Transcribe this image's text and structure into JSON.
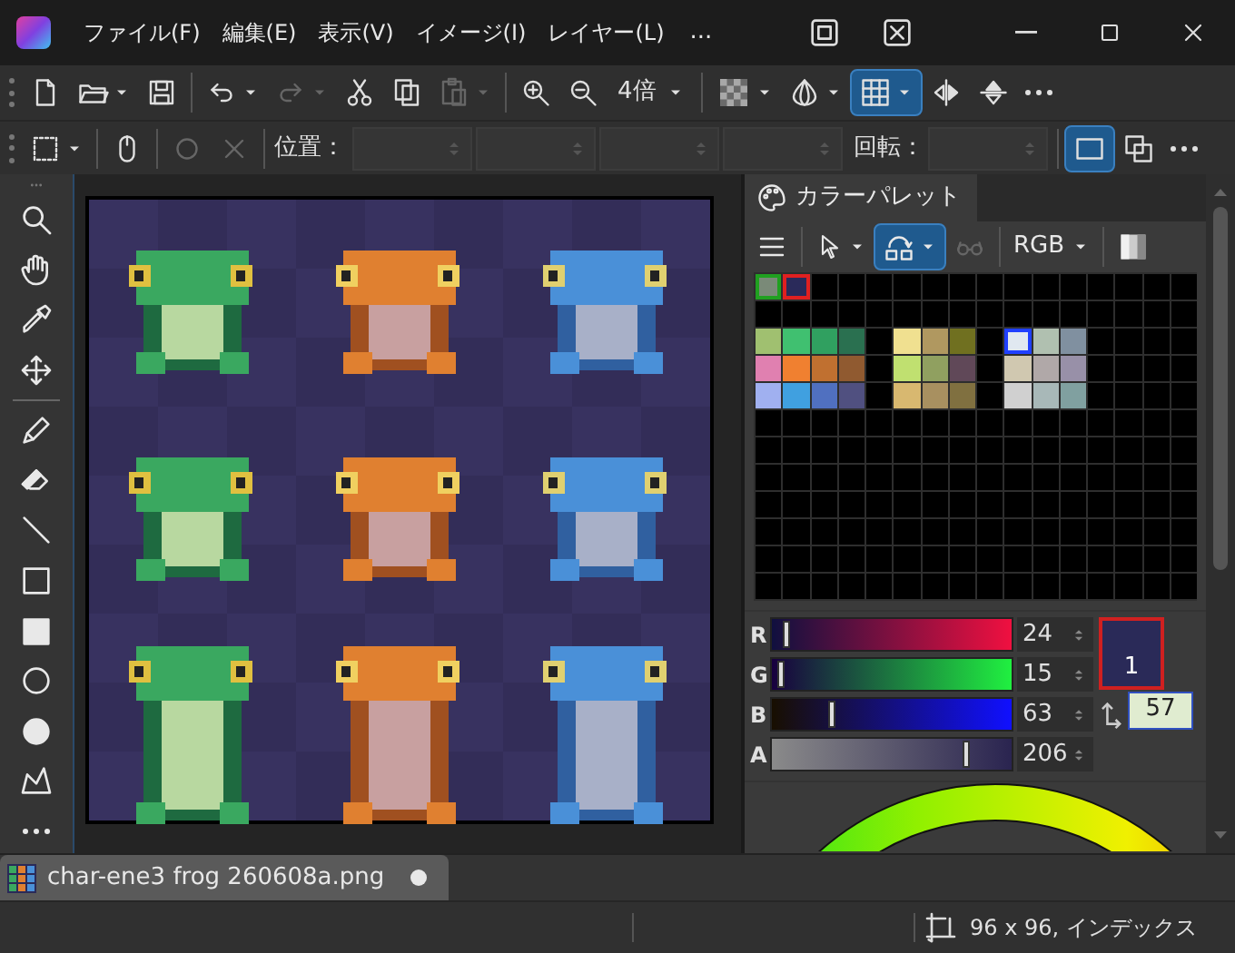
{
  "title_bar": {
    "menus": [
      "ファイル(F)",
      "編集(E)",
      "表示(V)",
      "イメージ(I)",
      "レイヤー(L)"
    ],
    "more": "..."
  },
  "main_toolbar": {
    "zoom_label": "4倍",
    "redo_button": {
      "disabled": true
    },
    "paste_button": {
      "disabled": true
    },
    "grid_button": {
      "selected": true
    }
  },
  "selection_toolbar": {
    "position_label": "位置：",
    "rotation_label": "回転：",
    "circle_button": {
      "disabled": true
    },
    "cancel_button": {
      "disabled": true
    },
    "frame_button": {
      "selected": true
    }
  },
  "palette_panel": {
    "title": "カラーパレット",
    "mode": "RGB",
    "transform_button": {
      "selected": true
    },
    "glasses_button": {
      "disabled": true
    },
    "swatch_rows": [
      [
        {
          "kind": "background",
          "color": "#7a8a78",
          "selected": false
        },
        {
          "kind": "foreground",
          "color": "#2a2a5a",
          "selected": false
        },
        {
          "kind": "swatch",
          "color": "#000000",
          "selected": false
        },
        {
          "kind": "swatch",
          "color": "#000000",
          "selected": false
        },
        {
          "kind": "swatch",
          "color": "#000000",
          "selected": false
        },
        {
          "kind": "swatch",
          "color": "#000000",
          "selected": false
        },
        {
          "kind": "swatch",
          "color": "#000000",
          "selected": false
        },
        {
          "kind": "swatch",
          "color": "#000000",
          "selected": false
        },
        {
          "kind": "swatch",
          "color": "#000000",
          "selected": false
        },
        {
          "kind": "swatch",
          "color": "#000000",
          "selected": false
        },
        {
          "kind": "swatch",
          "color": "#000000",
          "selected": false
        },
        {
          "kind": "swatch",
          "color": "#000000",
          "selected": false
        },
        {
          "kind": "swatch",
          "color": "#000000",
          "selected": false
        },
        {
          "kind": "swatch",
          "color": "#000000",
          "selected": false
        },
        {
          "kind": "swatch",
          "color": "#000000",
          "selected": false
        },
        {
          "kind": "swatch",
          "color": "#000000",
          "selected": false
        }
      ],
      [
        {
          "kind": "swatch",
          "color": "#000000",
          "selected": false
        },
        {
          "kind": "swatch",
          "color": "#000000",
          "selected": false
        },
        {
          "kind": "swatch",
          "color": "#000000",
          "selected": false
        },
        {
          "kind": "swatch",
          "color": "#000000",
          "selected": false
        },
        {
          "kind": "swatch",
          "color": "#000000",
          "selected": false
        },
        {
          "kind": "swatch",
          "color": "#000000",
          "selected": false
        },
        {
          "kind": "swatch",
          "color": "#000000",
          "selected": false
        },
        {
          "kind": "swatch",
          "color": "#000000",
          "selected": false
        },
        {
          "kind": "swatch",
          "color": "#000000",
          "selected": false
        },
        {
          "kind": "swatch",
          "color": "#000000",
          "selected": false
        },
        {
          "kind": "swatch",
          "color": "#000000",
          "selected": false
        },
        {
          "kind": "swatch",
          "color": "#000000",
          "selected": false
        },
        {
          "kind": "swatch",
          "color": "#000000",
          "selected": false
        },
        {
          "kind": "swatch",
          "color": "#000000",
          "selected": false
        },
        {
          "kind": "swatch",
          "color": "#000000",
          "selected": false
        },
        {
          "kind": "swatch",
          "color": "#000000",
          "selected": false
        }
      ],
      [
        {
          "kind": "swatch",
          "color": "#a0c070",
          "selected": false
        },
        {
          "kind": "swatch",
          "color": "#40c070",
          "selected": false
        },
        {
          "kind": "swatch",
          "color": "#30a060",
          "selected": false
        },
        {
          "kind": "swatch",
          "color": "#2a7050",
          "selected": false
        },
        {
          "kind": "swatch",
          "color": "#000000",
          "selected": false
        },
        {
          "kind": "swatch",
          "color": "#f0e090",
          "selected": false
        },
        {
          "kind": "swatch",
          "color": "#b09860",
          "selected": false
        },
        {
          "kind": "swatch",
          "color": "#707020",
          "selected": false
        },
        {
          "kind": "swatch",
          "color": "#000000",
          "selected": false
        },
        {
          "kind": "swatch",
          "color": "#e0e8f0",
          "selected": true
        },
        {
          "kind": "swatch",
          "color": "#b0c0b0",
          "selected": false
        },
        {
          "kind": "swatch",
          "color": "#8090a0",
          "selected": false
        },
        {
          "kind": "swatch",
          "color": "#000000",
          "selected": false
        },
        {
          "kind": "swatch",
          "color": "#000000",
          "selected": false
        },
        {
          "kind": "swatch",
          "color": "#000000",
          "selected": false
        },
        {
          "kind": "swatch",
          "color": "#000000",
          "selected": false
        }
      ],
      [
        {
          "kind": "swatch",
          "color": "#e080b0",
          "selected": false
        },
        {
          "kind": "swatch",
          "color": "#f08030",
          "selected": false
        },
        {
          "kind": "swatch",
          "color": "#c07030",
          "selected": false
        },
        {
          "kind": "swatch",
          "color": "#905a30",
          "selected": false
        },
        {
          "kind": "swatch",
          "color": "#000000",
          "selected": false
        },
        {
          "kind": "swatch",
          "color": "#c0e070",
          "selected": false
        },
        {
          "kind": "swatch",
          "color": "#90a060",
          "selected": false
        },
        {
          "kind": "swatch",
          "color": "#604858",
          "selected": false
        },
        {
          "kind": "swatch",
          "color": "#000000",
          "selected": false
        },
        {
          "kind": "swatch",
          "color": "#d0c8b0",
          "selected": false
        },
        {
          "kind": "swatch",
          "color": "#b0a8a8",
          "selected": false
        },
        {
          "kind": "swatch",
          "color": "#9890a8",
          "selected": false
        },
        {
          "kind": "swatch",
          "color": "#000000",
          "selected": false
        },
        {
          "kind": "swatch",
          "color": "#000000",
          "selected": false
        },
        {
          "kind": "swatch",
          "color": "#000000",
          "selected": false
        },
        {
          "kind": "swatch",
          "color": "#000000",
          "selected": false
        }
      ],
      [
        {
          "kind": "swatch",
          "color": "#a0b0f0",
          "selected": false
        },
        {
          "kind": "swatch",
          "color": "#40a0e0",
          "selected": false
        },
        {
          "kind": "swatch",
          "color": "#5070c0",
          "selected": false
        },
        {
          "kind": "swatch",
          "color": "#505080",
          "selected": false
        },
        {
          "kind": "swatch",
          "color": "#000000",
          "selected": false
        },
        {
          "kind": "swatch",
          "color": "#d8b870",
          "selected": false
        },
        {
          "kind": "swatch",
          "color": "#a89060",
          "selected": false
        },
        {
          "kind": "swatch",
          "color": "#807040",
          "selected": false
        },
        {
          "kind": "swatch",
          "color": "#000000",
          "selected": false
        },
        {
          "kind": "swatch",
          "color": "#d0d0d0",
          "selected": false
        },
        {
          "kind": "swatch",
          "color": "#a8b8b8",
          "selected": false
        },
        {
          "kind": "swatch",
          "color": "#80a0a0",
          "selected": false
        },
        {
          "kind": "swatch",
          "color": "#000000",
          "selected": false
        },
        {
          "kind": "swatch",
          "color": "#000000",
          "selected": false
        },
        {
          "kind": "swatch",
          "color": "#000000",
          "selected": false
        },
        {
          "kind": "swatch",
          "color": "#000000",
          "selected": false
        }
      ]
    ],
    "channels": [
      {
        "label": "R",
        "value": "24",
        "level": 0.06
      },
      {
        "label": "G",
        "value": "15",
        "level": 0.04
      },
      {
        "label": "B",
        "value": "63",
        "level": 0.25
      },
      {
        "label": "A",
        "value": "206",
        "level": 0.81
      }
    ],
    "foreground_index": "1",
    "background_index": "57"
  },
  "document_tabs": [
    {
      "name": "char-ene3 frog 260608a.png",
      "selected": true,
      "modified": true
    }
  ],
  "status_bar": {
    "image_info": "96 x 96, インデックス"
  }
}
